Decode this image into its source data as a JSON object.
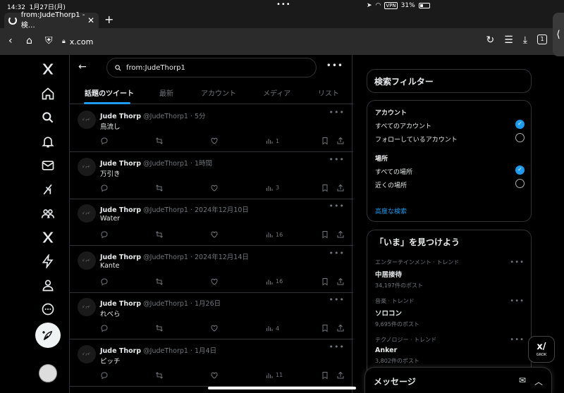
{
  "status": {
    "time": "14:32",
    "date": "1月27日(月)",
    "battery": "31%",
    "vpn": "VPN"
  },
  "browser": {
    "tab_title": "from:JudeThorp1 - 検…",
    "url": "x.com",
    "tab_count": "1"
  },
  "search": {
    "query": "from:JudeThorp1"
  },
  "tabs": [
    "話題のツイート",
    "最新",
    "アカウント",
    "メディア",
    "リスト"
  ],
  "tweets": [
    {
      "name": "Jude Thorp",
      "meta": "@JudeThorp1 · 5分",
      "text": "鳥流し",
      "views": "1"
    },
    {
      "name": "Jude Thorp",
      "meta": "@JudeThorp1 · 1時間",
      "text": "万引き",
      "views": "3"
    },
    {
      "name": "Jude Thorp",
      "meta": "@JudeThorp1 · 2024年12月10日",
      "text": "Water",
      "views": "16"
    },
    {
      "name": "Jude Thorp",
      "meta": "@JudeThorp1 · 2024年12月14日",
      "text": "Kante",
      "views": "16"
    },
    {
      "name": "Jude Thorp",
      "meta": "@JudeThorp1 · 1月26日",
      "text": "れべら",
      "views": "4"
    },
    {
      "name": "Jude Thorp",
      "meta": "@JudeThorp1 · 1月4日",
      "text": "ピッチ",
      "views": "11"
    }
  ],
  "filters": {
    "title": "検索フィルター",
    "account_label": "アカウント",
    "account_options": [
      "すべてのアカウント",
      "フォローしているアカウント"
    ],
    "place_label": "場所",
    "place_options": [
      "すべての場所",
      "近くの場所"
    ],
    "advanced": "高度な検索"
  },
  "trends": {
    "title": "「いま」を見つけよう",
    "items": [
      {
        "category": "エンターテインメント · トレンド",
        "topic": "中居接待",
        "count": "34,197件のポスト"
      },
      {
        "category": "音楽 · トレンド",
        "topic": "ソロコン",
        "count": "9,695件のポスト"
      },
      {
        "category": "テクノロジー · トレンド",
        "topic": "Anker",
        "count": "3,802件のポスト"
      }
    ]
  },
  "grok": {
    "label": "GROK"
  },
  "messages": {
    "title": "メッセージ"
  },
  "colors": {
    "accent": "#1d9bf0",
    "border": "#2f3336",
    "muted": "#71767b"
  }
}
